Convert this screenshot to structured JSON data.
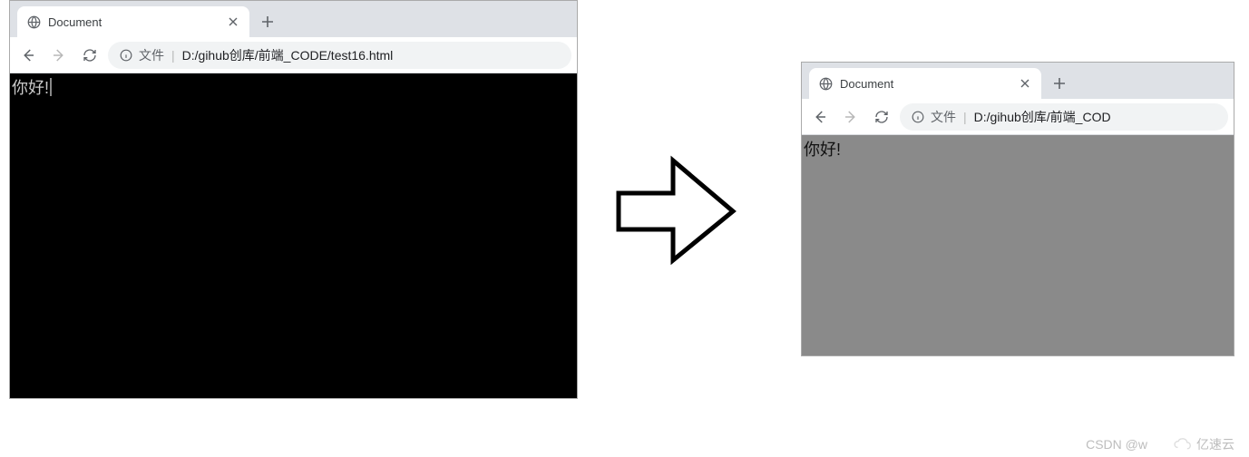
{
  "left": {
    "tab_title": "Document",
    "addr_prefix": "文件",
    "addr_url": "D:/gihub创库/前端_CODE/test16.html",
    "page_text": "你好!"
  },
  "right": {
    "tab_title": "Document",
    "addr_prefix": "文件",
    "addr_url": "D:/gihub创库/前端_COD",
    "page_text": "你好!"
  },
  "watermark": {
    "left_text": "CSDN @w",
    "right_text": "亿速云"
  }
}
